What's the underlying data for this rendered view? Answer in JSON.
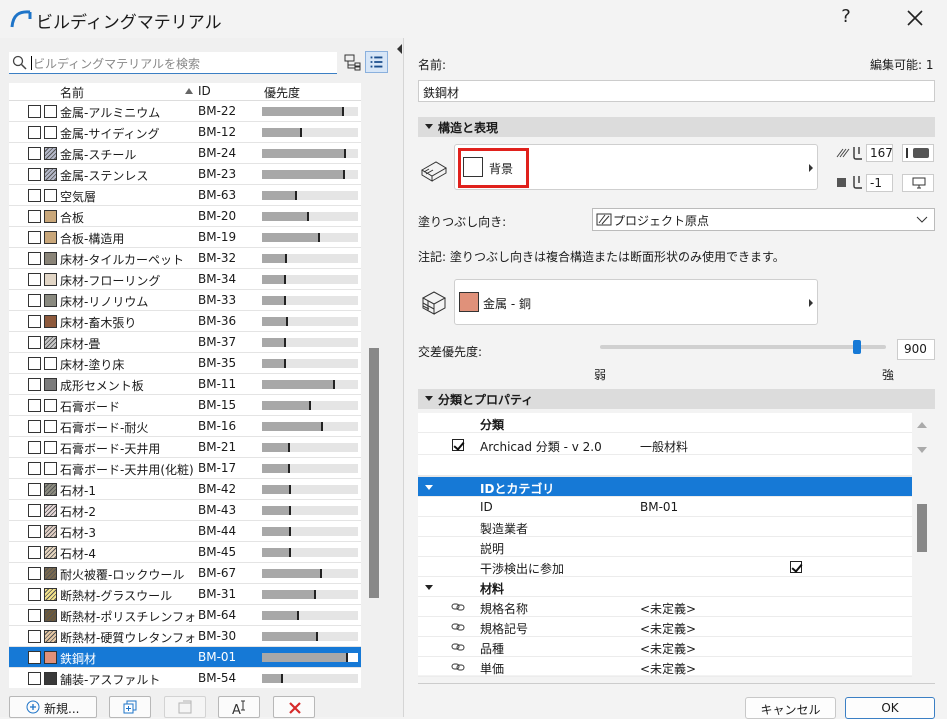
{
  "window": {
    "title": "ビルディングマテリアル",
    "help": "?"
  },
  "search": {
    "placeholder": "ビルディングマテリアルを検索"
  },
  "list": {
    "columns": {
      "name": "名前",
      "id": "ID",
      "priority": "優先度"
    },
    "rows": [
      {
        "name": "金属-アルミニウム",
        "id": "BM-22",
        "color": "#ffffff",
        "hatch": false,
        "priority": 0.85
      },
      {
        "name": "金属-サイディング",
        "id": "BM-12",
        "color": "#ffffff",
        "hatch": false,
        "priority": 0.42
      },
      {
        "name": "金属-スチール",
        "id": "BM-24",
        "color": "#b4b8c8",
        "hatch": true,
        "priority": 0.88
      },
      {
        "name": "金属-ステンレス",
        "id": "BM-23",
        "color": "#b4b8c8",
        "hatch": true,
        "priority": 0.86
      },
      {
        "name": "空気層",
        "id": "BM-63",
        "color": "#ffffff",
        "hatch": false,
        "priority": 0.36
      },
      {
        "name": "合板",
        "id": "BM-20",
        "color": "#c9a77a",
        "hatch": false,
        "priority": 0.49
      },
      {
        "name": "合板-構造用",
        "id": "BM-19",
        "color": "#c9a77a",
        "hatch": false,
        "priority": 0.6
      },
      {
        "name": "床材-タイルカーペット",
        "id": "BM-32",
        "color": "#8a8478",
        "hatch": false,
        "priority": 0.26
      },
      {
        "name": "床材-フローリング",
        "id": "BM-34",
        "color": "#e2d6c6",
        "hatch": false,
        "priority": 0.25
      },
      {
        "name": "床材-リノリウム",
        "id": "BM-33",
        "color": "#8a8a80",
        "hatch": false,
        "priority": 0.25
      },
      {
        "name": "床材-畜木張り",
        "id": "BM-36",
        "color": "#8e5a3c",
        "hatch": false,
        "priority": 0.27
      },
      {
        "name": "床材-畳",
        "id": "BM-37",
        "color": "#c8c8c8",
        "hatch": true,
        "priority": 0.25
      },
      {
        "name": "床材-塗り床",
        "id": "BM-35",
        "color": "#ffffff",
        "hatch": false,
        "priority": 0.25
      },
      {
        "name": "成形セメント板",
        "id": "BM-11",
        "color": "#7c7c7c",
        "hatch": false,
        "priority": 0.76
      },
      {
        "name": "石膏ボード",
        "id": "BM-15",
        "color": "#ffffff",
        "hatch": false,
        "priority": 0.51
      },
      {
        "name": "石膏ボード-耐火",
        "id": "BM-16",
        "color": "#ffffff",
        "hatch": false,
        "priority": 0.64
      },
      {
        "name": "石膏ボード-天井用",
        "id": "BM-21",
        "color": "#ffffff",
        "hatch": false,
        "priority": 0.29
      },
      {
        "name": "石膏ボード-天井用(化粧)",
        "id": "BM-17",
        "color": "#ffffff",
        "hatch": false,
        "priority": 0.29
      },
      {
        "name": "石材-1",
        "id": "BM-42",
        "color": "#8c8c80",
        "hatch": true,
        "priority": 0.3
      },
      {
        "name": "石材-2",
        "id": "BM-43",
        "color": "#e6d8d8",
        "hatch": true,
        "priority": 0.3
      },
      {
        "name": "石材-3",
        "id": "BM-44",
        "color": "#e2d0c6",
        "hatch": true,
        "priority": 0.3
      },
      {
        "name": "石材-4",
        "id": "BM-45",
        "color": "#e8d7c0",
        "hatch": true,
        "priority": 0.3
      },
      {
        "name": "耐火被覆-ロックウール",
        "id": "BM-67",
        "color": "#7a6a50",
        "hatch": true,
        "priority": 0.63
      },
      {
        "name": "断熱材-グラスウール",
        "id": "BM-31",
        "color": "#f2e28a",
        "hatch": true,
        "priority": 0.56
      },
      {
        "name": "断熱材-ポリスチレンフォーム",
        "id": "BM-64",
        "color": "#6e5a3a",
        "hatch": true,
        "priority": 0.39
      },
      {
        "name": "断熱材-硬質ウレタンフォ...",
        "id": "BM-30",
        "color": "#e6c8a4",
        "hatch": true,
        "priority": 0.58
      },
      {
        "name": "鉄鋼材",
        "id": "BM-01",
        "color": "#e0917a",
        "hatch": false,
        "priority": 0.9,
        "selected": true
      },
      {
        "name": "舗装-アスファルト",
        "id": "BM-54",
        "color": "#3a3a3a",
        "hatch": false,
        "priority": 0.22
      }
    ]
  },
  "bottom_buttons": {
    "new": "新規..."
  },
  "details": {
    "name_label": "名前:",
    "editable_label": "編集可能: 1",
    "name_value": "鉄鋼材",
    "structure_section": "構造と表現",
    "cut_fill_label": "背景",
    "pen_value": "167",
    "bg_pen_value": "-1",
    "fill_orientation_label": "塗りつぶし向き:",
    "fill_orientation_value": "プロジェクト原点",
    "note": "注記: 塗りつぶし向きは複合構造または断面形状のみ使用できます。",
    "surface_label": "金属 - 銅",
    "surface_color": "#e0917a",
    "intersection_label": "交差優先度:",
    "intersection_value": "900",
    "intersection_level": 0.9,
    "weak_label": "弱",
    "strong_label": "強",
    "classification_section": "分類とプロパティ",
    "classification_header": "分類",
    "classification_system": "Archicad 分類 - v 2.0",
    "classification_value": "一般材料",
    "id_category_header": "IDとカテゴリ",
    "props": [
      {
        "label": "ID",
        "value": "BM-01"
      },
      {
        "label": "製造業者",
        "value": ""
      },
      {
        "label": "説明",
        "value": ""
      },
      {
        "label": "干渉検出に参加",
        "value": ""
      }
    ],
    "material_header": "材料",
    "material_props": [
      {
        "label": "規格名称",
        "value": "<未定義>"
      },
      {
        "label": "規格記号",
        "value": "<未定義>"
      },
      {
        "label": "品種",
        "value": "<未定義>"
      },
      {
        "label": "単価",
        "value": "<未定義>"
      }
    ],
    "cancel": "キャンセル",
    "ok": "OK"
  }
}
